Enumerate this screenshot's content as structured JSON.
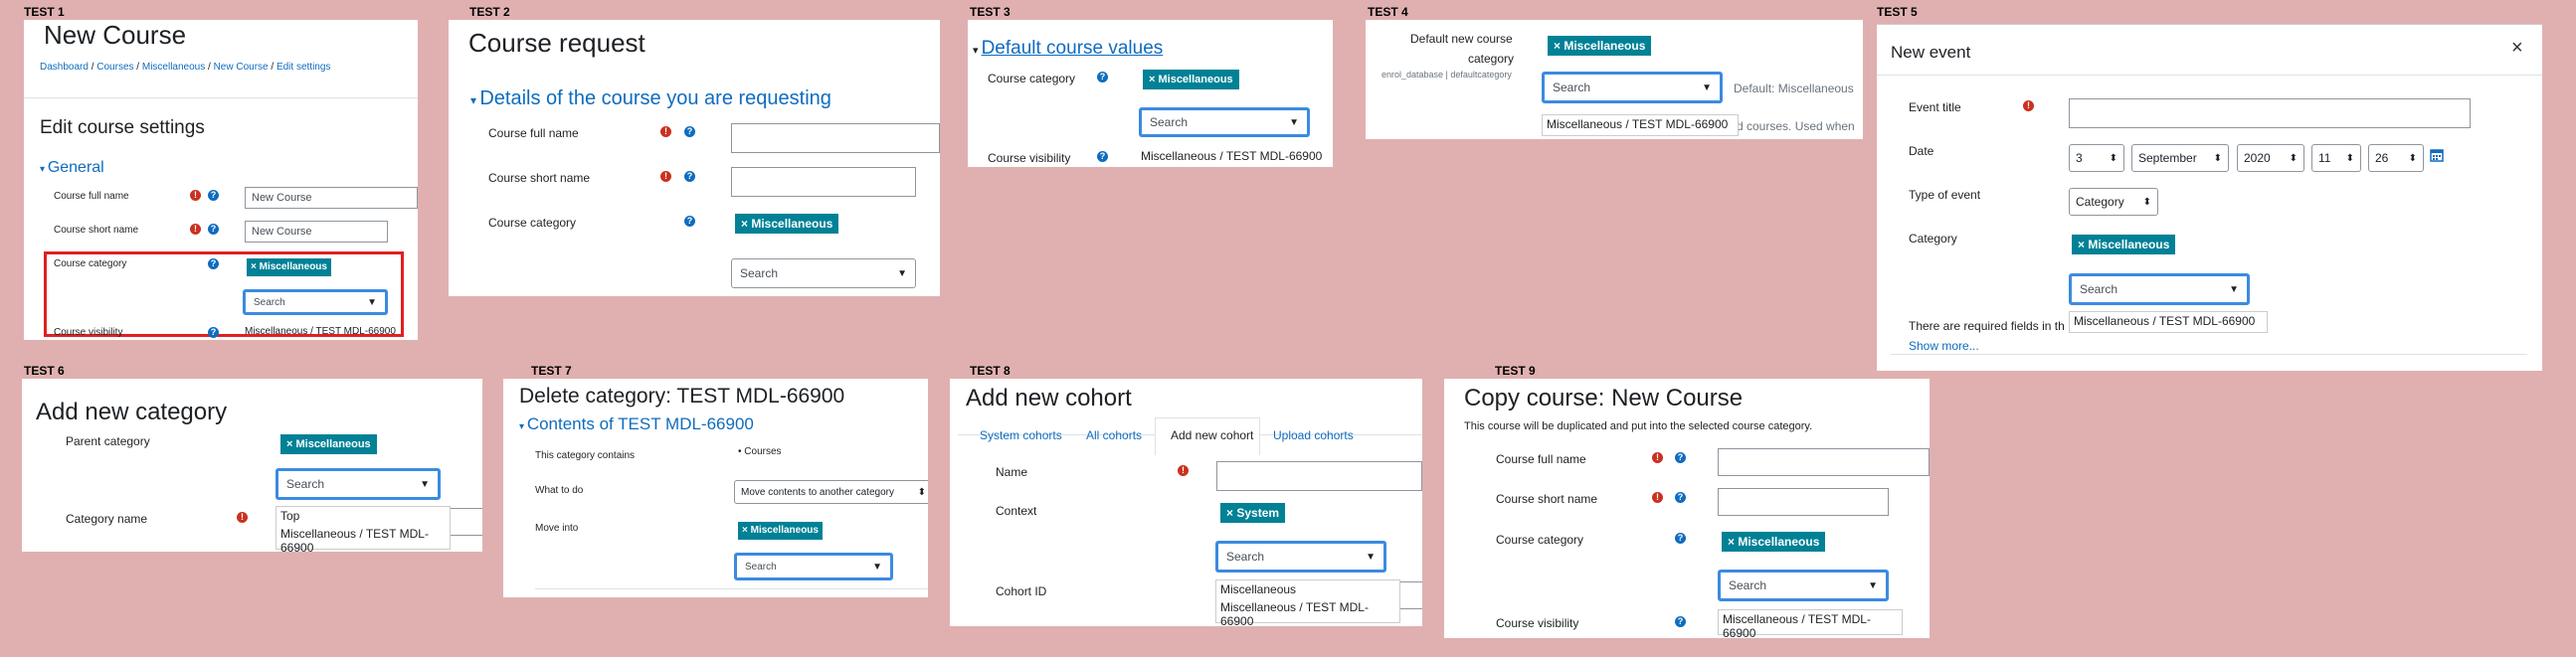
{
  "labels": [
    "TEST 1",
    "TEST 2",
    "TEST 3",
    "TEST 4",
    "TEST 5",
    "TEST 6",
    "TEST 7",
    "TEST 8",
    "TEST 9"
  ],
  "common": {
    "badge": "× Miscellaneous",
    "search": "Search",
    "caret": "▼",
    "option_misc": "Miscellaneous",
    "option_test": "Miscellaneous / TEST MDL-66900",
    "option_top": "Top",
    "req_icon": "!",
    "help_icon": "?"
  },
  "t1": {
    "title": "New Course",
    "breadcrumb": [
      "Dashboard",
      "Courses",
      "Miscellaneous",
      "New Course",
      "Edit settings"
    ],
    "heading": "Edit course settings",
    "section": "General",
    "full_name_label": "Course full name",
    "full_name_value": "New Course",
    "short_name_label": "Course short name",
    "short_name_value": "New Course",
    "category_label": "Course category",
    "visibility_label": "Course visibility",
    "visibility_value": "Miscellaneous / TEST MDL-66900"
  },
  "t2": {
    "title": "Course request",
    "section": "Details of the course you are requesting",
    "full_name_label": "Course full name",
    "short_name_label": "Course short name",
    "category_label": "Course category"
  },
  "t3": {
    "section": "Default course values",
    "category_label": "Course category",
    "visibility_label": "Course visibility",
    "visibility_value": "Miscellaneous / TEST MDL-66900"
  },
  "t4": {
    "label_line1": "Default new course",
    "label_line2": "category",
    "sublabel": "enrol_database | defaultcategory",
    "default_text": "Default: Miscellaneous",
    "behind_text": "d courses. Used when"
  },
  "t5": {
    "title": "New event",
    "close": "×",
    "event_title_label": "Event title",
    "date_label": "Date",
    "date_day": "3",
    "date_month": "September",
    "date_year": "2020",
    "date_hour": "11",
    "date_minute": "26",
    "type_label": "Type of event",
    "type_value": "Category",
    "category_label": "Category",
    "required_text": "There are required fields in th",
    "show_more": "Show more..."
  },
  "t6": {
    "title": "Add new category",
    "parent_label": "Parent category",
    "name_label": "Category name"
  },
  "t7": {
    "title": "Delete category: TEST MDL-66900",
    "section": "Contents of TEST MDL-66900",
    "contains_label": "This category contains",
    "contains_value": "• Courses",
    "what_label": "What to do",
    "what_value": "Move contents to another category",
    "move_label": "Move into"
  },
  "t8": {
    "title": "Add new cohort",
    "tabs": [
      "System cohorts",
      "All cohorts",
      "Add new cohort",
      "Upload cohorts"
    ],
    "name_label": "Name",
    "context_label": "Context",
    "context_badge": "× System",
    "cohort_id_label": "Cohort ID"
  },
  "t9": {
    "title": "Copy course: New Course",
    "description": "This course will be duplicated and put into the selected course category.",
    "full_name_label": "Course full name",
    "short_name_label": "Course short name",
    "category_label": "Course category",
    "visibility_label": "Course visibility",
    "visibility_value": "Miscellaneous / TEST MDL-66900"
  }
}
